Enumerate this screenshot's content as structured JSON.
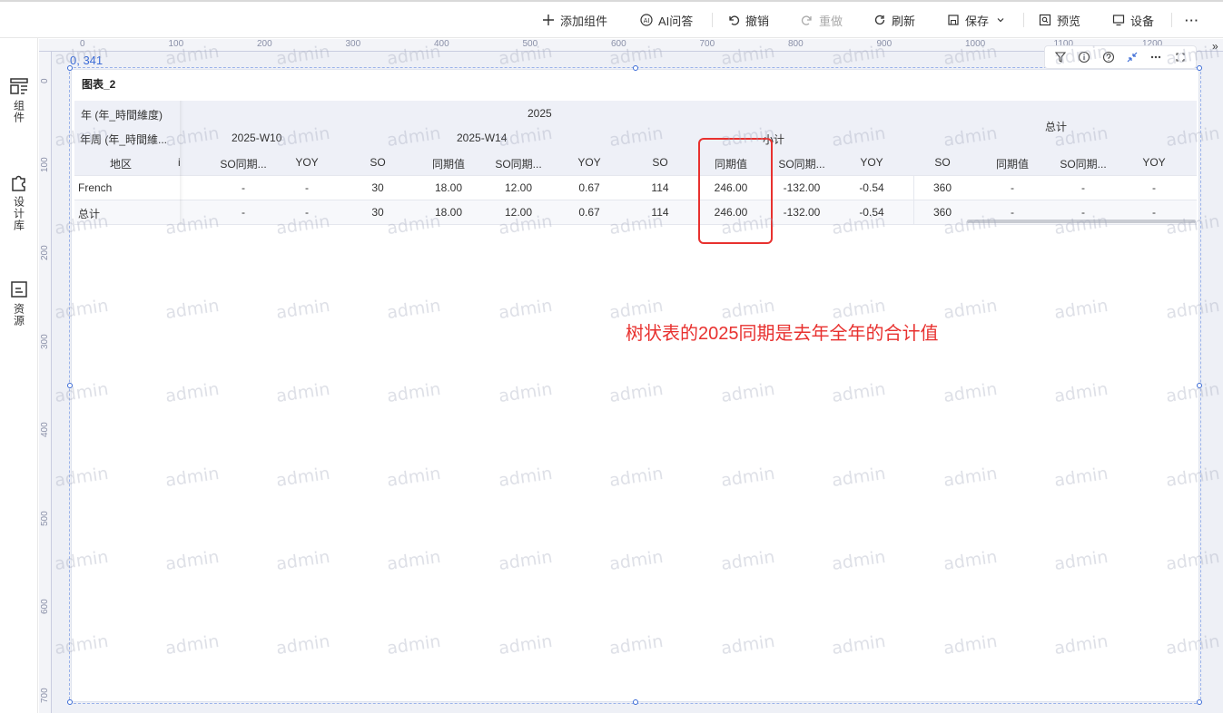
{
  "toolbar": {
    "add_widget": "添加组件",
    "ai_qa": "AI问答",
    "undo": "撤销",
    "redo": "重做",
    "refresh": "刷新",
    "save": "保存",
    "preview": "预览",
    "settings": "设备",
    "more": "···"
  },
  "sidebar": {
    "items": [
      {
        "label": "组件",
        "icon": "widgets-icon"
      },
      {
        "label": "设计库",
        "icon": "puzzle-icon"
      },
      {
        "label": "资源",
        "icon": "resource-icon"
      }
    ]
  },
  "ruler": {
    "top": [
      "0",
      "100",
      "200",
      "300",
      "400",
      "500",
      "600",
      "700",
      "800",
      "900",
      "1000",
      "1100",
      "1200"
    ],
    "left": [
      "0",
      "100",
      "200",
      "300",
      "400",
      "500",
      "600",
      "700"
    ]
  },
  "canvas": {
    "coordinate": "0, 341",
    "collapse": "»"
  },
  "widget": {
    "title": "图表_2",
    "watermark": "admin"
  },
  "table": {
    "row_dim_year": "年 (年_時間維度)",
    "row_dim_week": "年周 (年_時間維...",
    "row_dim_region": "地区",
    "row_dim_region_extra": "i",
    "year_2025": "2025",
    "total_col": "总计",
    "subtotal_col": "小计",
    "week_w10": "2025-W10",
    "week_w14": "2025-W14",
    "measures": [
      "SO同期...",
      "YOY",
      "SO",
      "同期值",
      "SO同期...",
      "YOY",
      "SO",
      "同期值",
      "SO同期...",
      "YOY",
      "SO",
      "同期值",
      "SO同期...",
      "YOY"
    ],
    "rows": [
      {
        "label": "French",
        "values": [
          "-",
          "-",
          "30",
          "18.00",
          "12.00",
          "0.67",
          "114",
          "246.00",
          "-132.00",
          "-0.54",
          "360",
          "-",
          "-",
          "-"
        ]
      },
      {
        "label": "总计",
        "values": [
          "-",
          "-",
          "30",
          "18.00",
          "12.00",
          "0.67",
          "114",
          "246.00",
          "-132.00",
          "-0.54",
          "360",
          "-",
          "-",
          "-"
        ]
      }
    ]
  },
  "annotation": {
    "text": "树状表的2025同期是去年全年的合计值"
  },
  "colors": {
    "accent": "#3b6bd6",
    "annotation": "#e8312f",
    "header_bg": "#eef0f7"
  }
}
